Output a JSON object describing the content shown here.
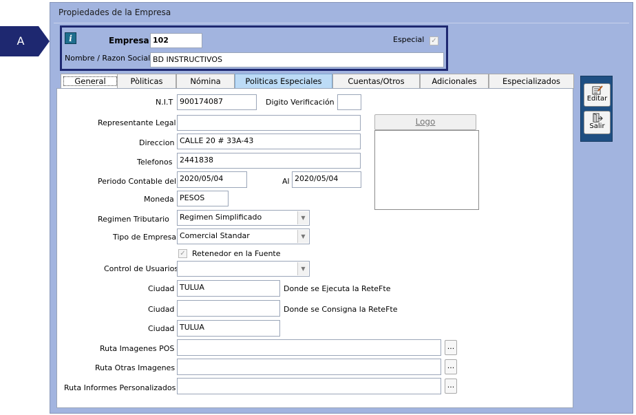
{
  "callout": {
    "letter": "A",
    "color": "#1e2870"
  },
  "window": {
    "title": "Propiedades de la Empresa",
    "background": "#a2b4df"
  },
  "header": {
    "info_icon": "i",
    "empresa_label": "Empresa",
    "empresa_value": "102",
    "especial_label": "Especial",
    "especial_checked": true,
    "razon_label": "Nombre / Razon Social",
    "razon_value": "BD INSTRUCTIVOS"
  },
  "tabs": [
    {
      "label": "General",
      "active": true
    },
    {
      "label": "Pòliticas",
      "active": false
    },
    {
      "label": "Nómina",
      "active": false
    },
    {
      "label": "Politicas Especiales",
      "active": false,
      "highlight": true
    },
    {
      "label": "Cuentas/Otros",
      "active": false
    },
    {
      "label": "Adicionales",
      "active": false
    },
    {
      "label": "Especializados",
      "active": false
    }
  ],
  "general": {
    "nit_label": "N.I.T",
    "nit_value": "900174087",
    "digito_label": "Digito Verificación :",
    "digito_value": "",
    "representante_label": "Representante Legal",
    "representante_value": "",
    "direccion_label": "Direccion",
    "direccion_value": "CALLE 20 # 33A-43",
    "telefonos_label": "Telefonos",
    "telefonos_value": "2441838",
    "periodo_label": "Periodo Contable del",
    "periodo_from": "2020/05/04",
    "al_label": "Al",
    "periodo_to": "2020/05/04",
    "moneda_label": "Moneda",
    "moneda_value": "PESOS",
    "logo_button": "Logo",
    "regimen_label": "Regimen Tributario",
    "regimen_value": "Regimen Simplificado",
    "tipo_label": "Tipo de Empresa",
    "tipo_value": "Comercial Standar",
    "retenedor_label": "Retenedor en la Fuente",
    "retenedor_checked": true,
    "control_label": "Control de Usuarios",
    "control_value": "",
    "ciudad1_label": "Ciudad",
    "ciudad1_value": "TULUA",
    "ciudad1_note": "Donde se Ejecuta  la ReteFte",
    "ciudad2_label": "Ciudad",
    "ciudad2_value": "",
    "ciudad2_note": "Donde se Consigna la ReteFte",
    "ciudad3_label": "Ciudad",
    "ciudad3_value": "TULUA",
    "ruta_pos_label": "Ruta Imagenes POS",
    "ruta_pos_value": "",
    "ruta_otras_label": "Ruta Otras Imagenes",
    "ruta_otras_value": "",
    "ruta_informes_label": "Ruta Informes Personalizados",
    "ruta_informes_value": "",
    "browse_label": "..."
  },
  "toolbar": {
    "editar_label": "Editar",
    "salir_label": "Salir",
    "editar_icon": "edit-form-icon",
    "salir_icon": "exit-door-icon"
  }
}
